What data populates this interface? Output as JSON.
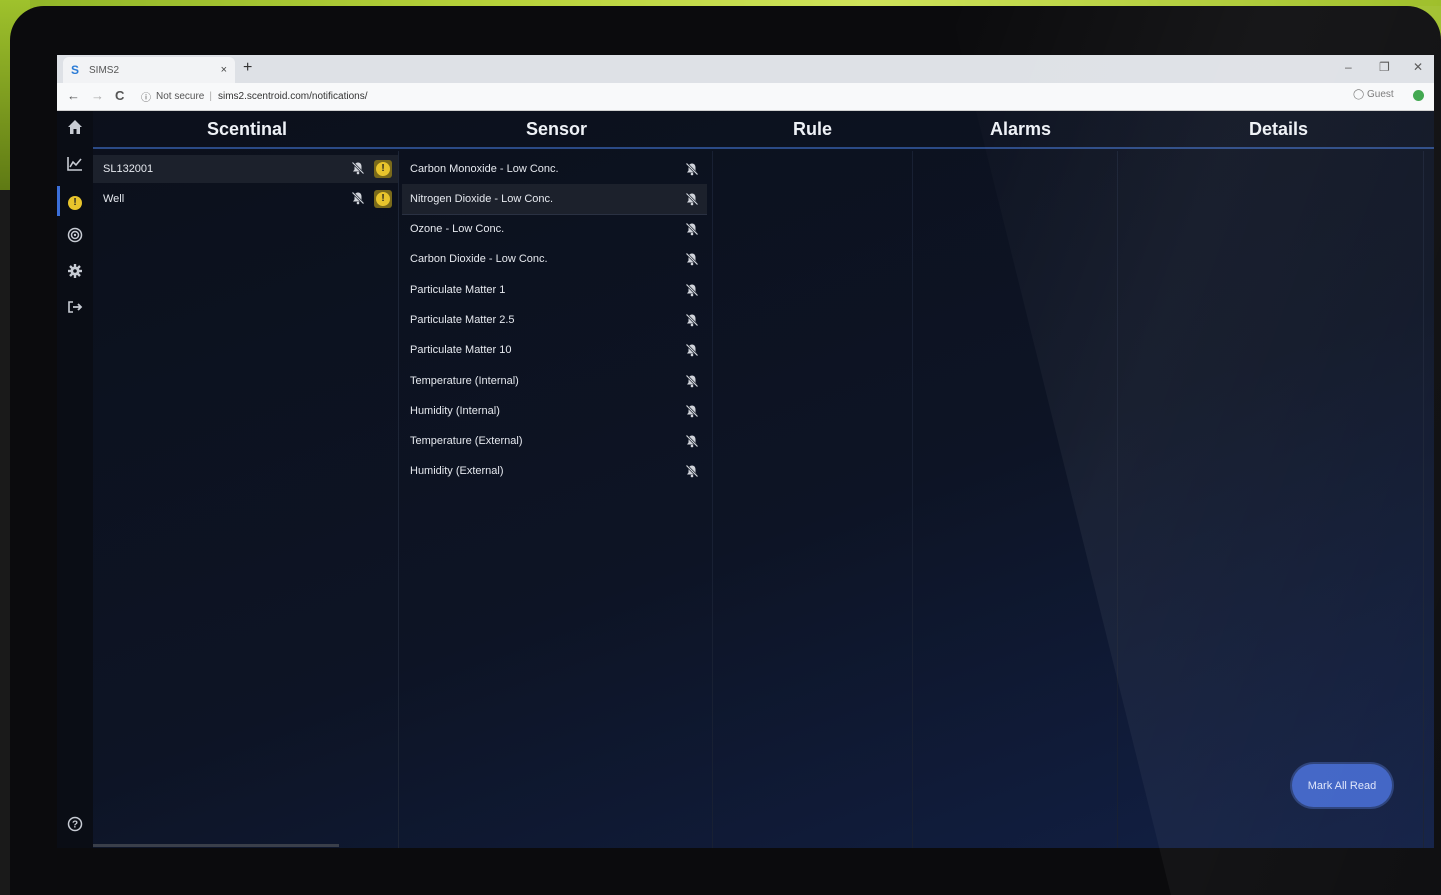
{
  "browser": {
    "tab_title": "SIMS2",
    "favicon": "S",
    "tab_close": "×",
    "new_tab": "+",
    "minimize": "–",
    "maximize": "❐",
    "close": "✕",
    "back": "←",
    "forward": "→",
    "reload": "C",
    "security_label": "Not secure",
    "url": "sims2.scentroid.com/notifications/",
    "profile_label": "Guest"
  },
  "columns": {
    "scentinal": "Scentinal",
    "sensor": "Sensor",
    "rule": "Rule",
    "alarms": "Alarms",
    "details": "Details"
  },
  "scentinals": [
    {
      "name": "SL132001"
    },
    {
      "name": "Well"
    }
  ],
  "sensors": [
    {
      "name": "Carbon Monoxide - Low Conc."
    },
    {
      "name": "Nitrogen Dioxide - Low Conc."
    },
    {
      "name": "Ozone - Low Conc."
    },
    {
      "name": "Carbon Dioxide - Low Conc."
    },
    {
      "name": "Particulate Matter 1"
    },
    {
      "name": "Particulate Matter 2.5"
    },
    {
      "name": "Particulate Matter 10"
    },
    {
      "name": "Temperature (Internal)"
    },
    {
      "name": "Humidity (Internal)"
    },
    {
      "name": "Temperature (External)"
    },
    {
      "name": "Humidity (External)"
    }
  ],
  "actions": {
    "mark_all_read": "Mark All Read"
  },
  "icons": {
    "home": "home-icon",
    "chart": "chart-icon",
    "alert": "alert-icon",
    "target": "target-icon",
    "gear": "gear-icon",
    "logout": "logout-icon",
    "help": "help-icon",
    "bell_off": "bell-off-icon"
  },
  "colors": {
    "accent": "#3f63c5",
    "alert": "#e8c42c",
    "background": "#0d1320"
  }
}
